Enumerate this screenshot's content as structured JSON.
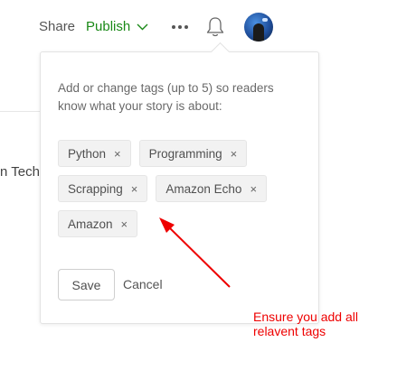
{
  "topbar": {
    "share_label": "Share",
    "publish_label": "Publish",
    "publish_color": "#1a8917",
    "more_icon": "more-horizontal-icon",
    "notification_icon": "bell-icon",
    "avatar": "user-avatar"
  },
  "background": {
    "partial_text": "n Tech"
  },
  "tag_popover": {
    "description": "Add or change tags (up to 5) so readers know what your story is about:",
    "tags": [
      {
        "label": "Python",
        "remove": "×"
      },
      {
        "label": "Programming",
        "remove": "×"
      },
      {
        "label": "Scrapping",
        "remove": "×"
      },
      {
        "label": "Amazon Echo",
        "remove": "×"
      },
      {
        "label": "Amazon",
        "remove": "×"
      }
    ],
    "save_label": "Save",
    "cancel_label": "Cancel"
  },
  "annotation": {
    "text": "Ensure you add all relavent tags",
    "color": "#ee0000"
  }
}
